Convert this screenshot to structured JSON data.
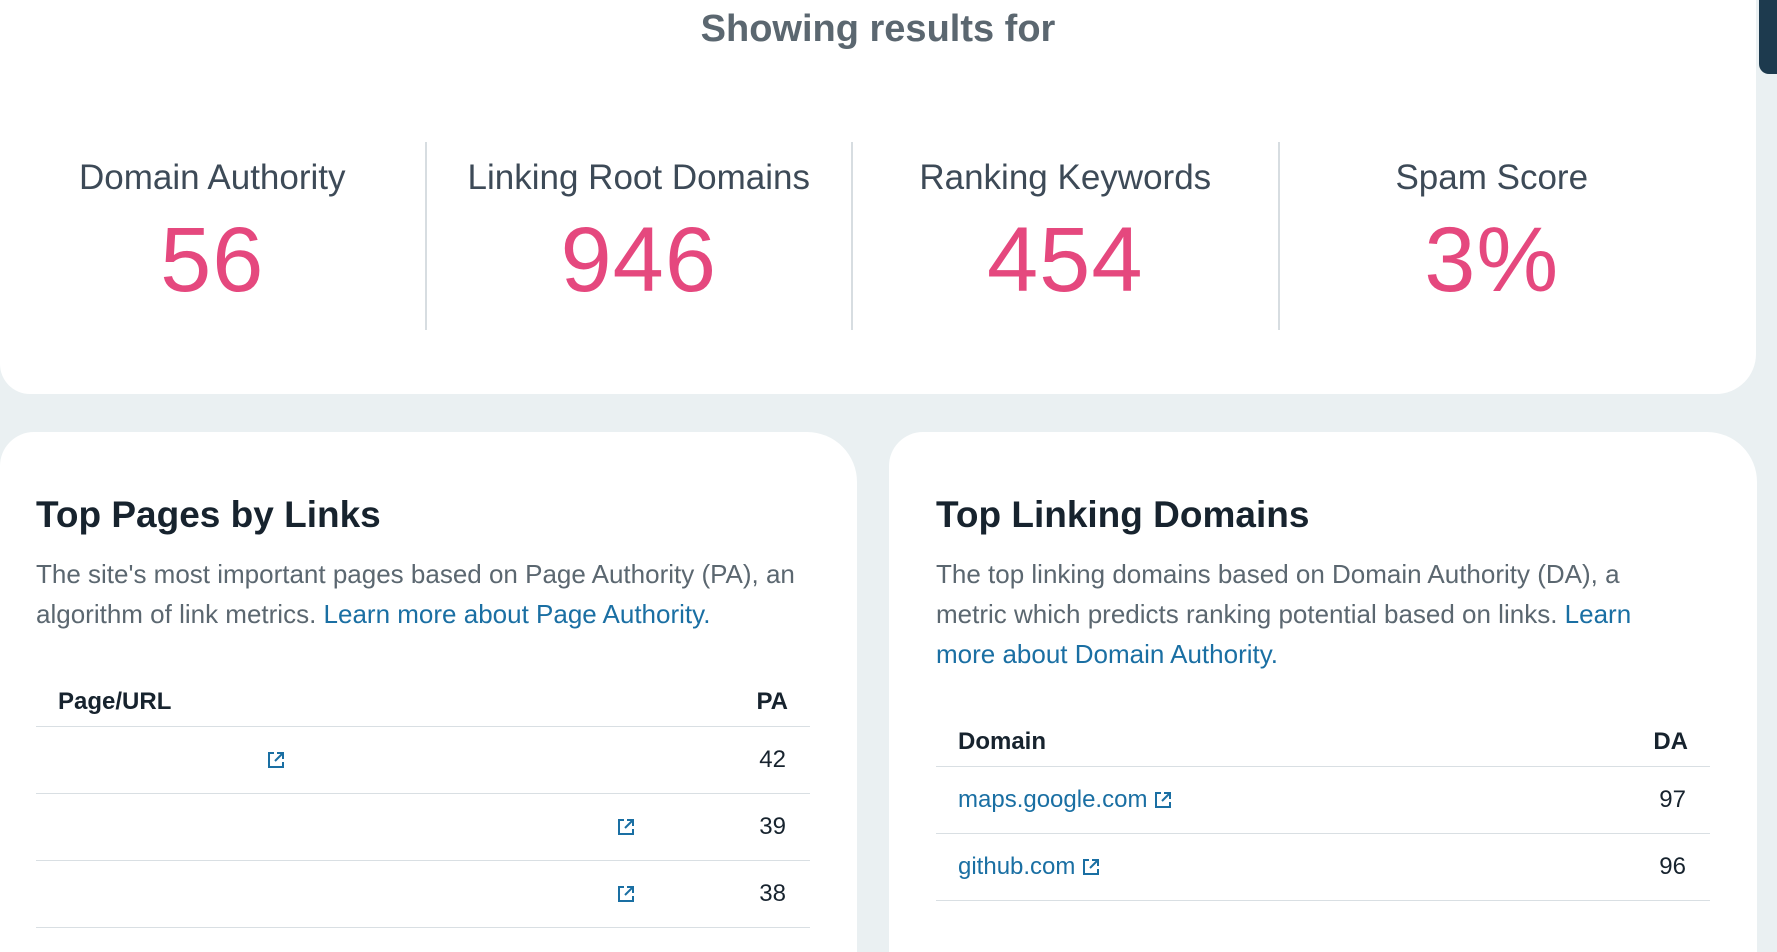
{
  "header": {
    "showing_label": "Showing results for"
  },
  "metrics": [
    {
      "label": "Domain Authority",
      "value": "56"
    },
    {
      "label": "Linking Root Domains",
      "value": "946"
    },
    {
      "label": "Ranking Keywords",
      "value": "454"
    },
    {
      "label": "Spam Score",
      "value": "3%"
    }
  ],
  "colors": {
    "accent": "#e5487e",
    "link": "#1a6fa3",
    "text_dark": "#17232e"
  },
  "top_pages": {
    "title": "Top Pages by Links",
    "description": "The site's most important pages based on Page Authority (PA), an algorithm of link metrics.",
    "learn_more": "Learn more about Page Authority.",
    "columns": [
      "Page/URL",
      "PA"
    ],
    "rows": [
      {
        "pa": "42",
        "icon": "external-link-icon"
      },
      {
        "pa": "39",
        "icon": "external-link-icon"
      },
      {
        "pa": "38",
        "icon": "external-link-icon"
      }
    ]
  },
  "top_domains": {
    "title": "Top Linking Domains",
    "description": "The top linking domains based on Domain Authority (DA), a metric which predicts ranking potential based on links.",
    "learn_more": "Learn more about Domain Authority.",
    "columns": [
      "Domain",
      "DA"
    ],
    "rows": [
      {
        "domain": "maps.google.com",
        "da": "97",
        "icon": "external-link-icon"
      },
      {
        "domain": "github.com",
        "da": "96",
        "icon": "external-link-icon"
      }
    ]
  }
}
